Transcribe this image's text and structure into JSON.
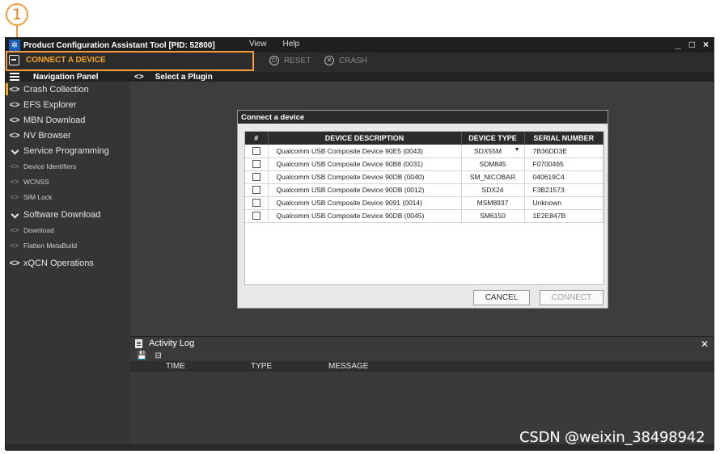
{
  "callout": {
    "number": "1"
  },
  "titlebar": {
    "title": "Product Configuration Assistant Tool [PID: 52800]",
    "menu": [
      "View",
      "Help"
    ],
    "controls": [
      "_",
      "□",
      "×"
    ]
  },
  "toolbar": {
    "connect_label": "CONNECT A DEVICE",
    "reset_label": "RESET",
    "crash_label": "CRASH",
    "accent_color": "#f5a623"
  },
  "nav": {
    "header": "Navigation Panel",
    "items": [
      {
        "label": "Crash Collection",
        "icon": "code-brackets-icon"
      },
      {
        "label": "EFS Explorer",
        "icon": "code-brackets-icon"
      },
      {
        "label": "MBN Download",
        "icon": "code-brackets-icon"
      },
      {
        "label": "NV Browser",
        "icon": "code-brackets-icon"
      },
      {
        "label": "Service Programming",
        "icon": "chevron-down-icon"
      },
      {
        "label": "Device Identifiers",
        "icon": "code-brackets-icon"
      },
      {
        "label": "WCNSS",
        "icon": "code-brackets-icon"
      },
      {
        "label": "SIM Lock",
        "icon": "code-brackets-icon"
      },
      {
        "label": "Software Download",
        "icon": "chevron-down-icon"
      },
      {
        "label": "Download",
        "icon": "code-brackets-icon"
      },
      {
        "label": "Flatten MetaBuild",
        "icon": "code-brackets-icon"
      },
      {
        "label": "xQCN Operations",
        "icon": "code-brackets-icon"
      }
    ]
  },
  "main": {
    "header": "Select a Plugin"
  },
  "dialog": {
    "title": "Connect a device",
    "columns": [
      "#",
      "DEVICE DESCRIPTION",
      "DEVICE TYPE",
      "SERIAL NUMBER"
    ],
    "rows": [
      {
        "description": "Qualcomm USB Composite Device 90E5 (0043)",
        "type": "SDX55M",
        "serial": "7B36DD3E"
      },
      {
        "description": "Qualcomm USB Composite Device 90B8 (0031)",
        "type": "SDM845",
        "serial": "F0700465"
      },
      {
        "description": "Qualcomm USB Composite Device 90DB (0040)",
        "type": "SM_NICOBAR",
        "serial": "040619C4"
      },
      {
        "description": "Qualcomm USB Composite Device 90DB (0012)",
        "type": "SDX24",
        "serial": "F3B21573"
      },
      {
        "description": "Qualcomm USB Composite Device 9091 (0014)",
        "type": "MSM8937",
        "serial": "Unknown"
      },
      {
        "description": "Qualcomm USB Composite Device 90DB (0045)",
        "type": "SM6150",
        "serial": "1E2E847B"
      }
    ],
    "cancel_label": "CANCEL",
    "connect_label": "CONNECT"
  },
  "log": {
    "title": "Activity Log",
    "columns": [
      "TIME",
      "TYPE",
      "MESSAGE"
    ]
  },
  "watermark": "CSDN @weixin_38498942"
}
